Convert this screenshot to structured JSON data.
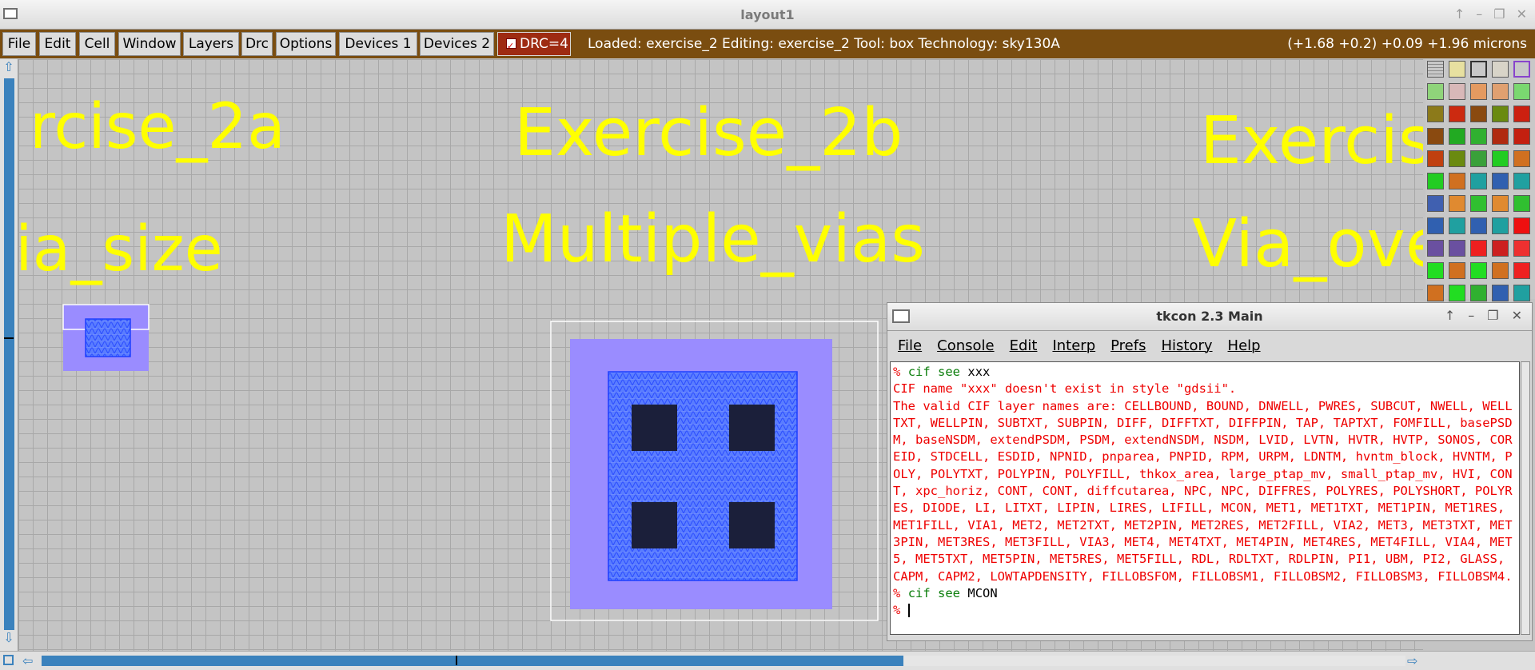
{
  "window": {
    "title": "layout1"
  },
  "menu": {
    "items": [
      "File",
      "Edit",
      "Cell",
      "Window",
      "Layers",
      "Drc",
      "Options",
      "Devices 1",
      "Devices 2"
    ],
    "drc_label": "DRC=4",
    "status": "Loaded: exercise_2 Editing: exercise_2 Tool: box  Technology: sky130A",
    "coords": "(+1.68 +0.2) +0.09 +1.96 microns"
  },
  "canvas": {
    "labels": {
      "ex2a_title": "rcise_2a",
      "ex2a_sub": "ia_size",
      "ex2b_title": "Exercise_2b",
      "ex2b_sub": "Multiple_vias",
      "ex2c_title": "Exercis",
      "ex2c_sub": "Via_ove"
    }
  },
  "tkcon": {
    "title": "tkcon 2.3 Main",
    "menu": [
      "File",
      "Console",
      "Edit",
      "Interp",
      "Prefs",
      "History",
      "Help"
    ],
    "lines": {
      "prompt": "%",
      "cmd1": "cif see",
      "arg1": "xxx",
      "err1": "CIF name \"xxx\" doesn't exist in style \"gdsii\".",
      "err2": "The valid CIF layer names are: CELLBOUND, BOUND, DNWELL, PWRES, SUBCUT, NWELL, WELLTXT, WELLPIN, SUBTXT, SUBPIN, DIFF, DIFFTXT, DIFFPIN, TAP, TAPTXT, FOMFILL, basePSDM, baseNSDM, extendPSDM, PSDM, extendNSDM, NSDM, LVID, LVTN, HVTR, HVTP, SONOS, COREID, STDCELL, ESDID, NPNID, pnparea, PNPID, RPM, URPM, LDNTM, hvntm_block, HVNTM, POLY, POLYTXT, POLYPIN, POLYFILL, thkox_area, large_ptap_mv, small_ptap_mv, HVI, CONT, xpc_horiz, CONT, CONT, diffcutarea, NPC, NPC, DIFFRES, POLYRES, POLYSHORT, POLYRES, DIODE, LI, LITXT, LIPIN, LIRES, LIFILL, MCON, MET1, MET1TXT, MET1PIN, MET1RES, MET1FILL, VIA1, MET2, MET2TXT, MET2PIN, MET2RES, MET2FILL, VIA2, MET3, MET3TXT, MET3PIN, MET3RES, MET3FILL, VIA3, MET4, MET4TXT, MET4PIN, MET4RES, MET4FILL, VIA4, MET5, MET5TXT, MET5PIN, MET5RES, MET5FILL, RDL, RDLTXT, RDLPIN, PI1, UBM, PI2, GLASS, CAPM, CAPM2, LOWTAPDENSITY, FILLOBSFOM, FILLOBSM1, FILLOBSM2, FILLOBSM3, FILLOBSM4.",
      "cmd2": "cif see",
      "arg2": "MCON"
    }
  },
  "colors": {
    "menubar": "#7a4d10",
    "drc_button": "#9e2b12",
    "label_text": "#ffff00",
    "met1": "#9a8cff",
    "via_hatch": "#3a66ff",
    "mcon": "#1b1f3a",
    "scroll_accent": "#3b82bd"
  },
  "icons": [
    "app-window-icon",
    "maximize-icon",
    "minimize-icon",
    "restore-icon",
    "close-icon",
    "scroll-up-icon",
    "scroll-down-icon",
    "scroll-left-icon",
    "scroll-right-icon"
  ]
}
